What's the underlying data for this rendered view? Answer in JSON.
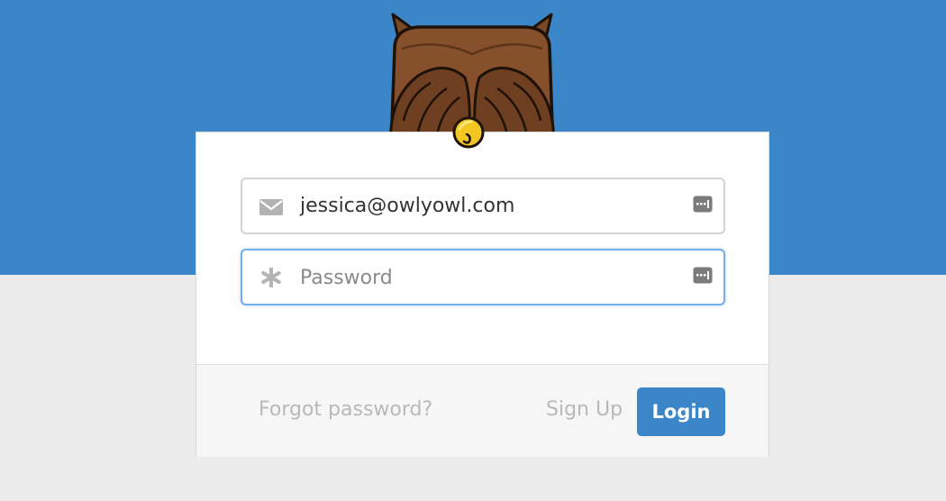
{
  "login_form": {
    "email_value": "jessica@owlyowl.com",
    "password_placeholder": "Password"
  },
  "footer": {
    "forgot_password_label": "Forgot password?",
    "sign_up_label": "Sign Up",
    "login_label": "Login"
  },
  "icons": {
    "email": "envelope-icon",
    "password": "asterisk-icon",
    "autofill": "password-keyboard-icon",
    "mascot": "owl-mascot",
    "bell": "bell-icon"
  },
  "colors": {
    "primary": "#3a86c8",
    "background": "#ececec",
    "muted_text": "#b9b9b9",
    "focus_border": "#77aee6"
  }
}
